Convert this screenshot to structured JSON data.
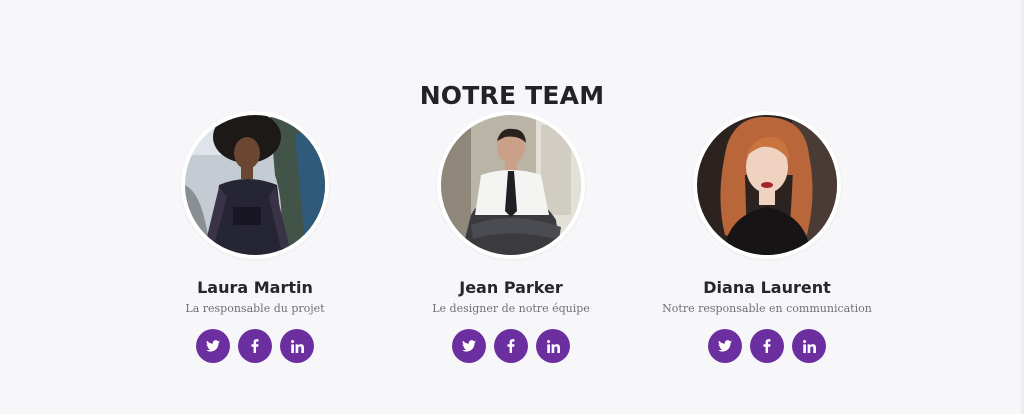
{
  "section": {
    "title": "NOTRE TEAM"
  },
  "members": [
    {
      "name": "Laura Martin",
      "role": "La responsable du projet",
      "socials": [
        "twitter-icon",
        "facebook-icon",
        "linkedin-icon"
      ]
    },
    {
      "name": "Jean Parker",
      "role": "Le designer de notre équipe",
      "socials": [
        "twitter-icon",
        "facebook-icon",
        "linkedin-icon"
      ]
    },
    {
      "name": "Diana Laurent",
      "role": "Notre responsable en communication",
      "socials": [
        "twitter-icon",
        "facebook-icon",
        "linkedin-icon"
      ]
    }
  ],
  "colors": {
    "accent": "#6b2fa0",
    "background": "#f7f7fa",
    "heading": "#222327",
    "muted": "#6f6f76"
  }
}
